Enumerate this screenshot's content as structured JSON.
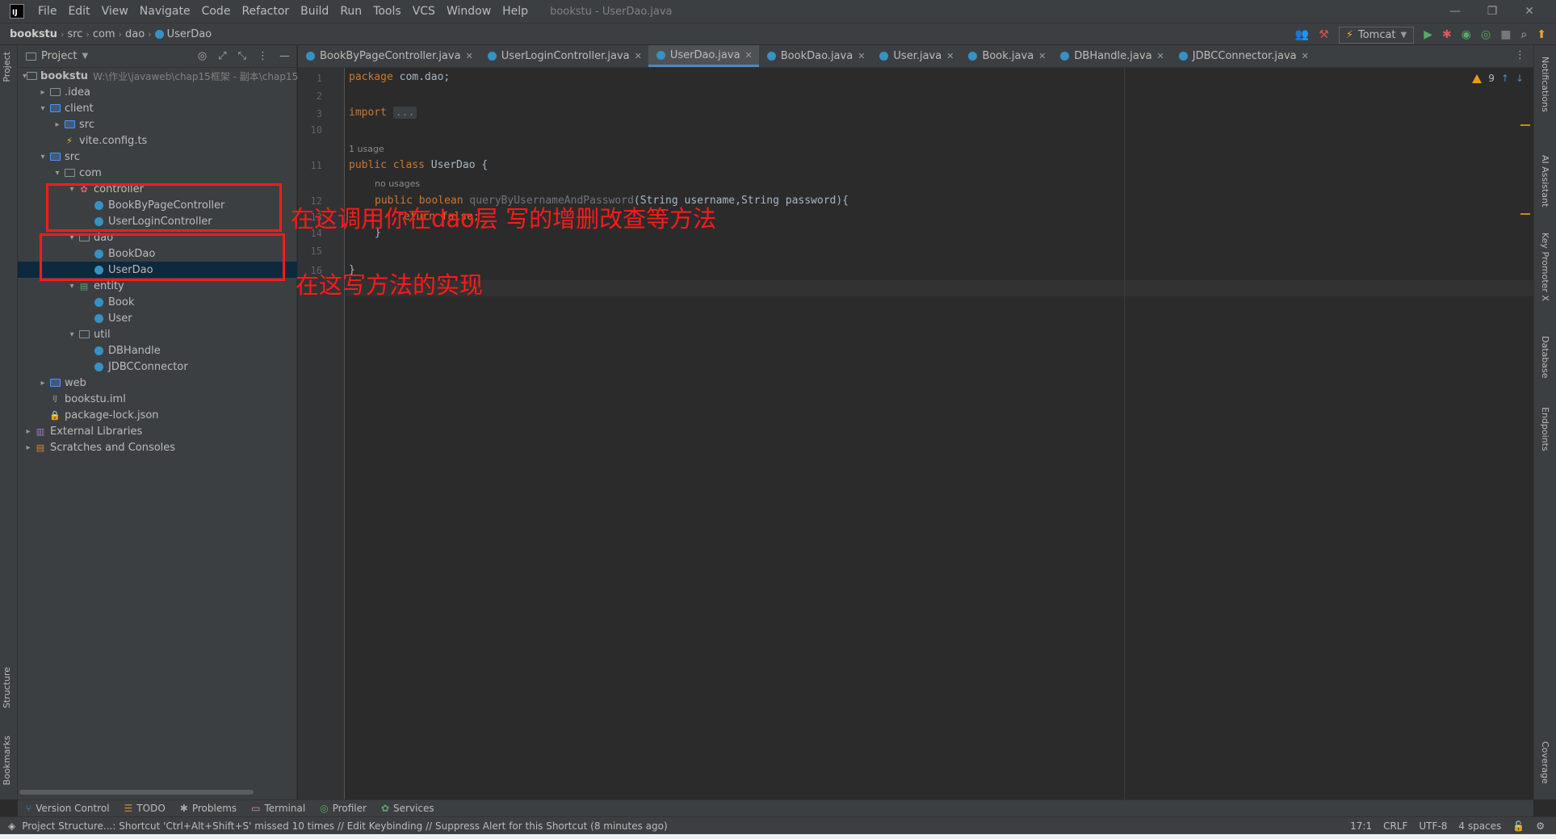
{
  "window": {
    "logo": "IJ",
    "menu": [
      "File",
      "Edit",
      "View",
      "Navigate",
      "Code",
      "Refactor",
      "Build",
      "Run",
      "Tools",
      "VCS",
      "Window",
      "Help"
    ],
    "title": "bookstu - UserDao.java",
    "controls": [
      "—",
      "❐",
      "✕"
    ]
  },
  "breadcrumb": [
    "bookstu",
    "src",
    "com",
    "dao",
    "UserDao"
  ],
  "toolbar": {
    "run_config": "Tomcat",
    "accent": "#4a88c7"
  },
  "left_strip": {
    "project": "Project",
    "structure": "Structure",
    "bookmarks": "Bookmarks"
  },
  "right_strip": {
    "notifications": "Notifications",
    "ai": "AI Assistant",
    "keypromoter": "Key Promoter X",
    "database": "Database",
    "endpoints": "Endpoints",
    "coverage": "Coverage"
  },
  "project_panel": {
    "title": "Project",
    "root_path": "W:\\作业\\javaweb\\chap15框架 - 副本\\chap15",
    "tree": [
      {
        "label": "bookstu",
        "bold": true,
        "arrow": "▾",
        "icon": "folder"
      },
      {
        "label": ".idea",
        "arrow": "▸",
        "icon": "folder"
      },
      {
        "label": "client",
        "arrow": "▾",
        "icon": "folder-blue"
      },
      {
        "label": "src",
        "arrow": "▸",
        "icon": "folder-blue"
      },
      {
        "label": "vite.config.ts",
        "arrow": "",
        "icon": "ts"
      },
      {
        "label": "src",
        "arrow": "▾",
        "icon": "folder-blue"
      },
      {
        "label": "com",
        "arrow": "▾",
        "icon": "folder"
      },
      {
        "label": "controller",
        "arrow": "▾",
        "icon": "pkg-red"
      },
      {
        "label": "BookByPageController",
        "arrow": "",
        "icon": "class"
      },
      {
        "label": "UserLoginController",
        "arrow": "",
        "icon": "class"
      },
      {
        "label": "dao",
        "arrow": "▾",
        "icon": "folder"
      },
      {
        "label": "BookDao",
        "arrow": "",
        "icon": "class"
      },
      {
        "label": "UserDao",
        "arrow": "",
        "icon": "class"
      },
      {
        "label": "entity",
        "arrow": "▾",
        "icon": "pkg-green"
      },
      {
        "label": "Book",
        "arrow": "",
        "icon": "class"
      },
      {
        "label": "User",
        "arrow": "",
        "icon": "class"
      },
      {
        "label": "util",
        "arrow": "▾",
        "icon": "folder"
      },
      {
        "label": "DBHandle",
        "arrow": "",
        "icon": "class"
      },
      {
        "label": "JDBCConnector",
        "arrow": "",
        "icon": "class"
      },
      {
        "label": "web",
        "arrow": "▸",
        "icon": "folder-blue"
      },
      {
        "label": "bookstu.iml",
        "arrow": "",
        "icon": "iml"
      },
      {
        "label": "package-lock.json",
        "arrow": "",
        "icon": "lock"
      },
      {
        "label": "External Libraries",
        "arrow": "▸",
        "icon": "lib"
      },
      {
        "label": "Scratches and Consoles",
        "arrow": "▸",
        "icon": "scratch"
      }
    ]
  },
  "tabs": [
    {
      "label": "BookByPageController.java",
      "active": false
    },
    {
      "label": "UserLoginController.java",
      "active": false
    },
    {
      "label": "UserDao.java",
      "active": true
    },
    {
      "label": "BookDao.java",
      "active": false
    },
    {
      "label": "User.java",
      "active": false
    },
    {
      "label": "Book.java",
      "active": false
    },
    {
      "label": "DBHandle.java",
      "active": false
    },
    {
      "label": "JDBCConnector.java",
      "active": false
    }
  ],
  "editor": {
    "warnings": "9",
    "line_numbers": [
      "1",
      "2",
      "3",
      "10",
      "",
      "11",
      "",
      "12",
      "13",
      "14",
      "15",
      "16"
    ],
    "code": {
      "l1_kw": "package",
      "l1_rest": " com.dao;",
      "l3_kw": "import",
      "l3_fold": "...",
      "usage_hint": "1 usage",
      "l11_kw": "public class",
      "l11_rest": " UserDao {",
      "no_usages_hint": "no usages",
      "l12_kw": "public boolean",
      "l12_method": " queryByUsernameAndPassword",
      "l12_params": "(String username,String password){",
      "l13": "return false;",
      "l14": "}",
      "l16": "}"
    }
  },
  "annotations": {
    "controller_note": "在这调用你在dao层 写的增删改查等方法",
    "dao_note": "在这写方法的实现",
    "color": "#ff1a1a"
  },
  "bottom_tools": [
    "Version Control",
    "TODO",
    "Problems",
    "Terminal",
    "Profiler",
    "Services"
  ],
  "status": {
    "message": "Project Structure...: Shortcut 'Ctrl+Alt+Shift+S' missed 10 times // Edit Keybinding // Suppress Alert for this Shortcut (8 minutes ago)",
    "position": "17:1",
    "line_sep": "CRLF",
    "encoding": "UTF-8",
    "indent": "4 spaces"
  }
}
